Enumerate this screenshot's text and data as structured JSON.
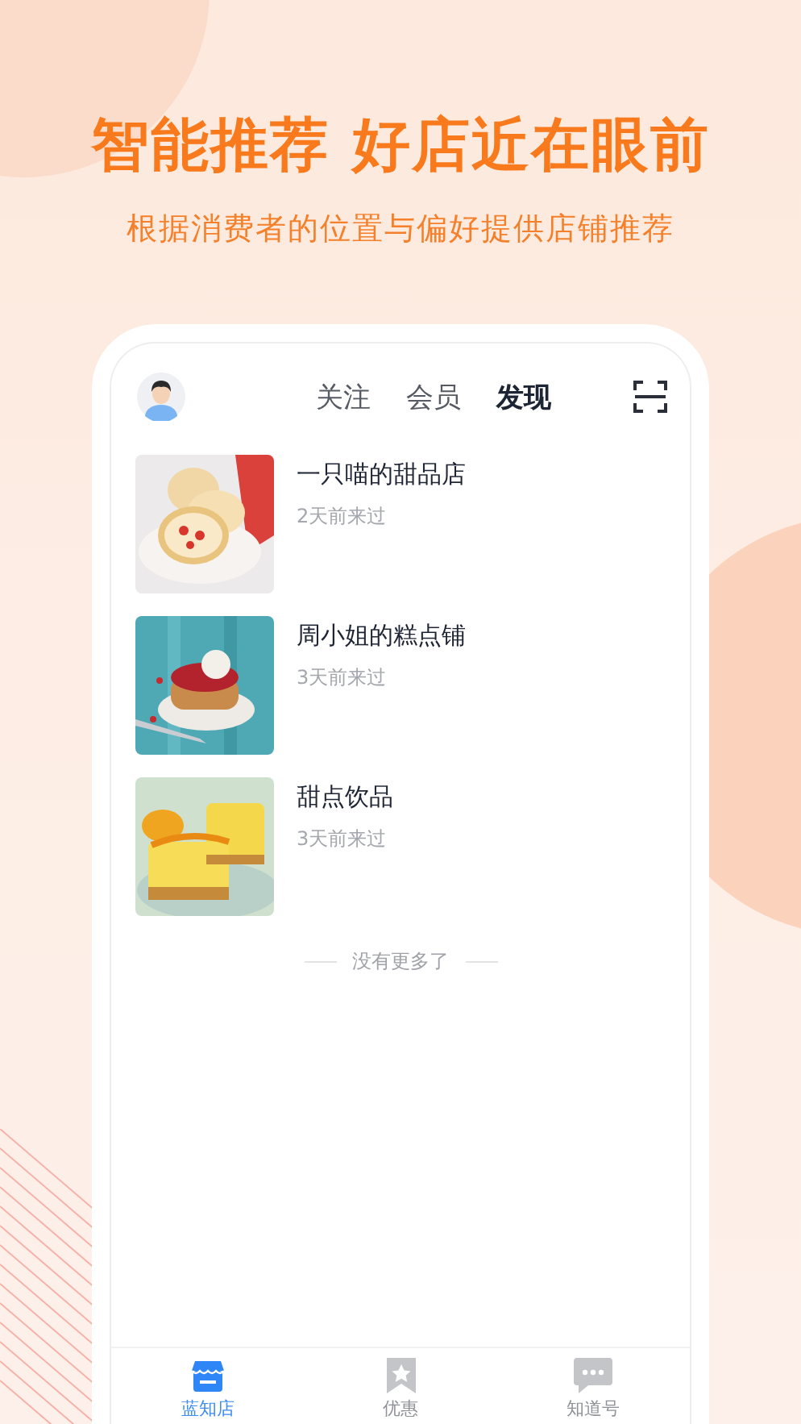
{
  "headline": "智能推荐 好店近在眼前",
  "subtitle": "根据消费者的位置与偏好提供店铺推荐",
  "top_tabs": [
    {
      "label": "关注",
      "selected": false
    },
    {
      "label": "会员",
      "selected": false
    },
    {
      "label": "发现",
      "selected": true
    }
  ],
  "shops": [
    {
      "name": "一只喵的甜品店",
      "visited": "2天前来过"
    },
    {
      "name": "周小姐的糕点铺",
      "visited": "3天前来过"
    },
    {
      "name": "甜点饮品",
      "visited": "3天前来过"
    }
  ],
  "end_note": "没有更多了",
  "bottom_tabs": [
    {
      "label": "蓝知店",
      "kind": "store",
      "selected": true
    },
    {
      "label": "优惠",
      "kind": "bookmark",
      "selected": false
    },
    {
      "label": "知道号",
      "kind": "chat",
      "selected": false
    }
  ]
}
